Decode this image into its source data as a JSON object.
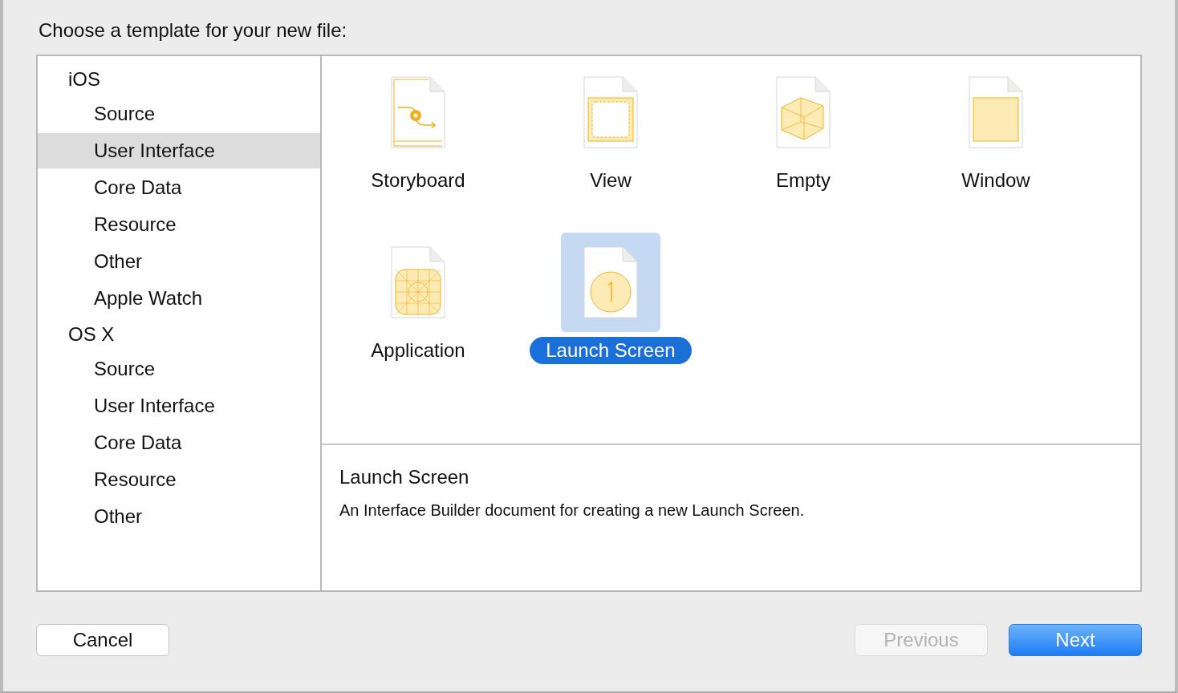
{
  "title": "Choose a template for your new file:",
  "sidebar": [
    {
      "header": "iOS",
      "items": [
        {
          "label": "Source",
          "selected": false
        },
        {
          "label": "User Interface",
          "selected": true
        },
        {
          "label": "Core Data",
          "selected": false
        },
        {
          "label": "Resource",
          "selected": false
        },
        {
          "label": "Other",
          "selected": false
        },
        {
          "label": "Apple Watch",
          "selected": false
        }
      ]
    },
    {
      "header": "OS X",
      "items": [
        {
          "label": "Source",
          "selected": false
        },
        {
          "label": "User Interface",
          "selected": false
        },
        {
          "label": "Core Data",
          "selected": false
        },
        {
          "label": "Resource",
          "selected": false
        },
        {
          "label": "Other",
          "selected": false
        }
      ]
    }
  ],
  "templates": [
    {
      "kind": "storyboard",
      "label": "Storyboard",
      "selected": false
    },
    {
      "kind": "view",
      "label": "View",
      "selected": false
    },
    {
      "kind": "empty",
      "label": "Empty",
      "selected": false
    },
    {
      "kind": "window",
      "label": "Window",
      "selected": false
    },
    {
      "kind": "application",
      "label": "Application",
      "selected": false
    },
    {
      "kind": "launch",
      "label": "Launch Screen",
      "selected": true
    }
  ],
  "description": {
    "title": "Launch Screen",
    "text": "An Interface Builder document for creating a new Launch Screen."
  },
  "buttons": [
    {
      "kind": "cancel",
      "label": "Cancel",
      "disabled": false
    },
    {
      "kind": "previous",
      "label": "Previous",
      "disabled": true
    },
    {
      "kind": "next",
      "label": "Next",
      "disabled": false
    }
  ]
}
